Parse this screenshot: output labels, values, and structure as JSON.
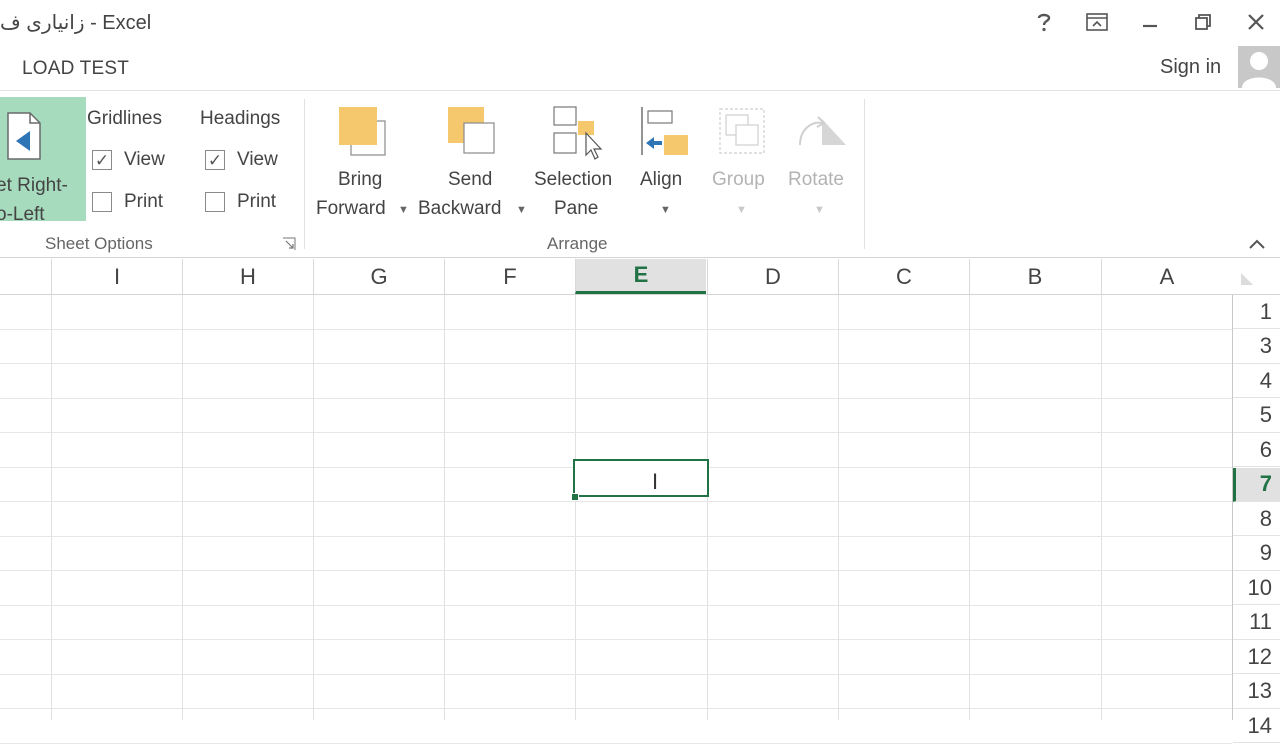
{
  "window": {
    "title": "زانیاری ف - Excel",
    "help_icon": "question-mark-icon",
    "ribbon_display_icon": "ribbon-display-options-icon",
    "minimize_icon": "minimize-icon",
    "restore_icon": "restore-icon",
    "close_icon": "close-icon"
  },
  "tabs": {
    "active_tab": "LOAD TEST",
    "sign_in": "Sign in"
  },
  "ribbon": {
    "sheet_options": {
      "sheet_rtl_line1": "et Right-",
      "sheet_rtl_line2": "o-Left",
      "gridlines": "Gridlines",
      "headings": "Headings",
      "view": "View",
      "print": "Print",
      "gridlines_view_checked": true,
      "gridlines_print_checked": false,
      "headings_view_checked": true,
      "headings_print_checked": false,
      "group_label": "Sheet Options"
    },
    "arrange": {
      "bring_forward_line1": "Bring",
      "bring_forward_line2": "Forward",
      "send_backward_line1": "Send",
      "send_backward_line2": "Backward",
      "selection_pane_line1": "Selection",
      "selection_pane_line2": "Pane",
      "align": "Align",
      "group": "Group",
      "rotate": "Rotate",
      "group_label": "Arrange"
    },
    "collapse_icon": "chevron-up-icon"
  },
  "grid": {
    "columns": [
      "I",
      "H",
      "G",
      "F",
      "E",
      "D",
      "C",
      "B",
      "A"
    ],
    "active_column": "E",
    "rows": [
      "1",
      "3",
      "4",
      "5",
      "6",
      "7",
      "8",
      "9",
      "10",
      "11",
      "12",
      "13",
      "14"
    ],
    "active_row": "7",
    "accent_color": "#217346"
  }
}
